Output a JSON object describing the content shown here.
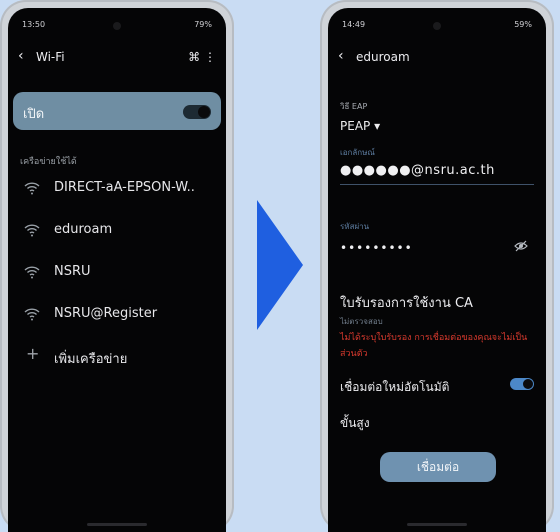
{
  "left_phone": {
    "status": {
      "time": "13:50",
      "right": "79%"
    },
    "header": {
      "title": "Wi-Fi",
      "tools": "⌘ ⋮"
    },
    "wifi_toggle": {
      "label": "เปิด",
      "on": true
    },
    "section_label": "เครือข่ายใช้ได้",
    "networks": [
      {
        "name": "DIRECT-aA-EPSON-W..",
        "icon": "wifi-icon"
      },
      {
        "name": "eduroam",
        "icon": "wifi-icon"
      },
      {
        "name": "NSRU",
        "icon": "wifi-icon"
      },
      {
        "name": "NSRU@Register",
        "icon": "wifi-icon"
      }
    ],
    "add_network": {
      "label": "เพิ่มเครือข่าย",
      "icon": "plus-icon"
    }
  },
  "right_phone": {
    "status": {
      "time": "14:49",
      "right": "59%"
    },
    "header": {
      "title": "eduroam"
    },
    "eap": {
      "label": "วิธี EAP",
      "value": "PEAP ▾"
    },
    "identity": {
      "label": "เอกลักษณ์",
      "value": "●●●●●●@nsru.ac.th"
    },
    "password": {
      "label": "รหัสผ่าน",
      "value": "•••••••••"
    },
    "ca_cert": {
      "title": "ใบรับรองการใช้งาน CA",
      "subtitle": "ไม่ตรวจสอบ"
    },
    "warning": "ไม่ได้ระบุใบรับรอง การเชื่อมต่อของคุณจะไม่เป็นส่วนตัว",
    "auto_reconnect": {
      "label": "เชื่อมต่อใหม่อัตโนมัติ",
      "on": true
    },
    "advanced": "ขั้นสูง",
    "connect_button": "เชื่อมต่อ"
  },
  "colors": {
    "background": "#c9dcf3",
    "arrow": "#1f5fe0",
    "accent": "#6f92b0",
    "warning": "#d83a2e"
  }
}
